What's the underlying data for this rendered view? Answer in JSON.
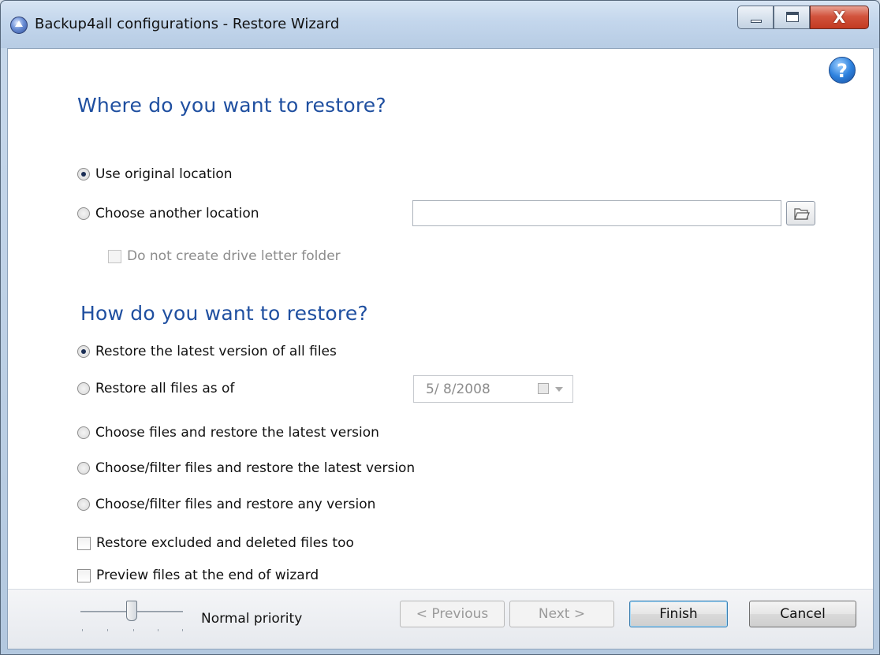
{
  "window": {
    "title": "Backup4all configurations - Restore Wizard",
    "close_glyph": "X"
  },
  "help": {
    "glyph": "?"
  },
  "where": {
    "heading": "Where do you want to restore?",
    "use_original": "Use original location",
    "choose_another": "Choose another location",
    "path_value": "",
    "no_drive_folder": "Do not create drive letter folder"
  },
  "how": {
    "heading": "How do you want to restore?",
    "options": [
      "Restore the latest version of all files",
      "Restore all files as of",
      "Choose files and restore the latest version",
      "Choose/filter files and restore the latest version",
      "Choose/filter files and restore any version"
    ],
    "selected_index": 0,
    "date_value": "5/ 8/2008",
    "restore_excluded": "Restore excluded and deleted files too",
    "preview_files": "Preview files at the end of wizard"
  },
  "footer": {
    "priority_label": "Normal priority",
    "priority_level": 0.5,
    "previous": "< Previous",
    "next": "Next >",
    "finish": "Finish",
    "cancel": "Cancel"
  },
  "icons": {
    "title": "app-icon",
    "help": "help-icon",
    "browse": "folder-icon",
    "calendar": "calendar-icon"
  }
}
